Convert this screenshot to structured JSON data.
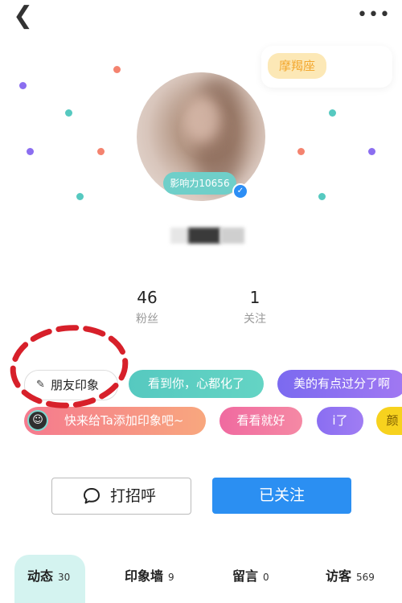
{
  "header": {
    "back_icon": "back-arrow-icon",
    "more_icon": "more-dots-icon"
  },
  "profile": {
    "zodiac": "摩羯座",
    "influence": "影响力10656",
    "followers_count": "46",
    "followers_label": "粉丝",
    "following_count": "1",
    "following_label": "关注"
  },
  "impressions": {
    "friend_impression_label": "朋友印象",
    "tags_row1": [
      "看到你，心都化了",
      "美的有点过分了啊"
    ],
    "add_prompt": "快来给Ta添加印象吧~",
    "tags_row2": [
      "看看就好",
      "i了",
      "颜"
    ]
  },
  "actions": {
    "greet_label": "打招呼",
    "followed_label": "已关注"
  },
  "tabs": [
    {
      "label": "动态",
      "count": "30"
    },
    {
      "label": "印象墙",
      "count": "9"
    },
    {
      "label": "留言",
      "count": "0"
    },
    {
      "label": "访客",
      "count": "569"
    }
  ],
  "colors": {
    "accent_blue": "#2b8ff2",
    "teal": "#6fcfc9",
    "annotation_red": "#d7202a"
  }
}
